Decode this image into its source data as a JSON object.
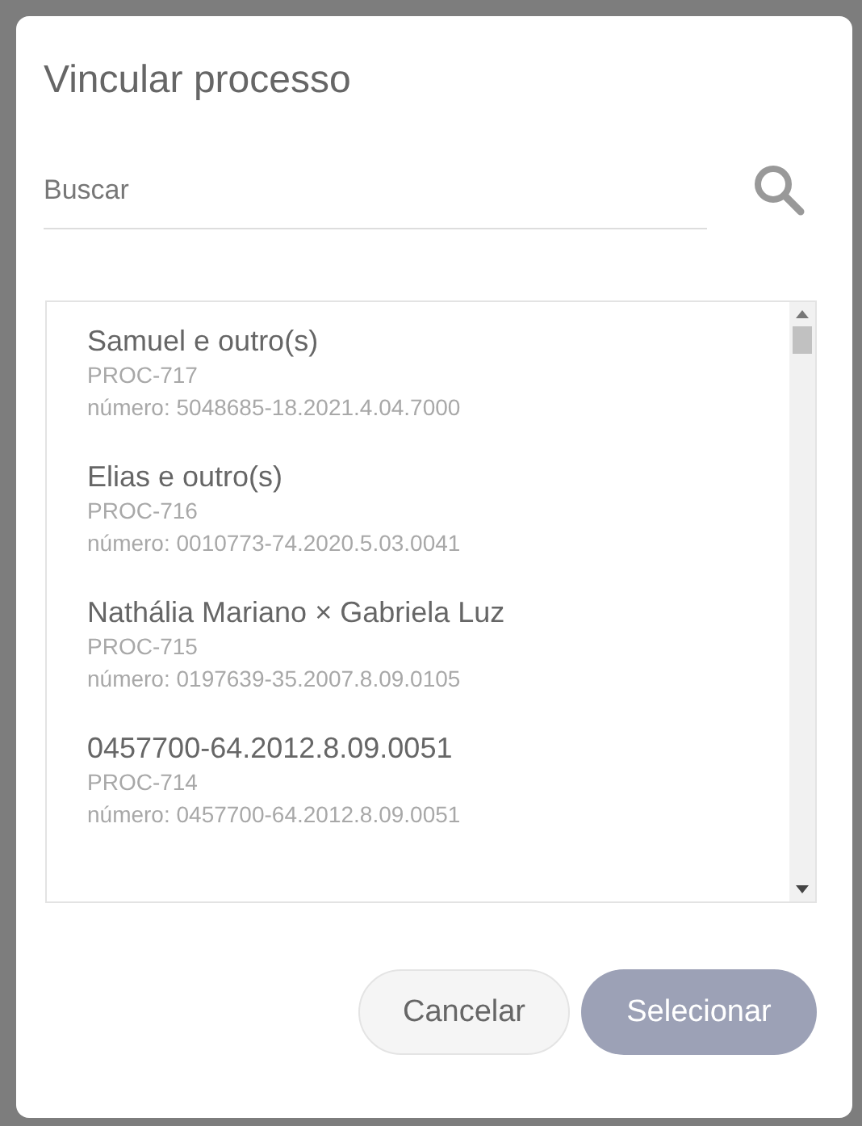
{
  "dialog": {
    "title": "Vincular processo"
  },
  "search": {
    "placeholder": "Buscar"
  },
  "processes": [
    {
      "title": "Samuel e outro(s)",
      "code": "PROC-717",
      "number": "número: 5048685-18.2021.4.04.7000"
    },
    {
      "title": "Elias e outro(s)",
      "code": "PROC-716",
      "number": "número: 0010773-74.2020.5.03.0041"
    },
    {
      "title": "Nathália Mariano × Gabriela Luz",
      "code": "PROC-715",
      "number": "número: 0197639-35.2007.8.09.0105"
    },
    {
      "title": "0457700-64.2012.8.09.0051",
      "code": "PROC-714",
      "number": "número: 0457700-64.2012.8.09.0051"
    }
  ],
  "buttons": [
    {
      "label": "Cancelar",
      "kind": "secondary",
      "disabled": false
    },
    {
      "label": "Selecionar",
      "kind": "primary",
      "disabled": true
    }
  ]
}
